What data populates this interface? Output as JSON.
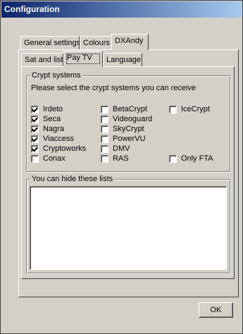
{
  "window": {
    "title": "Configuration"
  },
  "main_tabs": [
    {
      "label": "General settings"
    },
    {
      "label": "Colours"
    },
    {
      "label": "DXAndy"
    }
  ],
  "sub_tabs": [
    {
      "label": "Sat and lists"
    },
    {
      "label": "Pay TV"
    },
    {
      "label": "Language"
    }
  ],
  "crypt": {
    "legend": "Crypt systems",
    "instruction": "Please select the crypt systems you can receive",
    "items": [
      {
        "label": "Irdeto",
        "checked": true
      },
      {
        "label": "Seca",
        "checked": true
      },
      {
        "label": "Nagra",
        "checked": true
      },
      {
        "label": "Viaccess",
        "checked": true
      },
      {
        "label": "Cryptoworks",
        "checked": true
      },
      {
        "label": "Conax",
        "checked": false
      },
      {
        "label": "BetaCrypt",
        "checked": false
      },
      {
        "label": "Videoguard",
        "checked": false
      },
      {
        "label": "SkyCrypt",
        "checked": false
      },
      {
        "label": "PowerVU",
        "checked": false
      },
      {
        "label": "DMV",
        "checked": false
      },
      {
        "label": "RAS",
        "checked": false
      },
      {
        "label": "IceCrypt",
        "checked": false
      },
      {
        "label": "Only FTA",
        "checked": false
      }
    ]
  },
  "hide": {
    "legend": "You can hide these lists"
  },
  "buttons": {
    "ok": "OK"
  }
}
